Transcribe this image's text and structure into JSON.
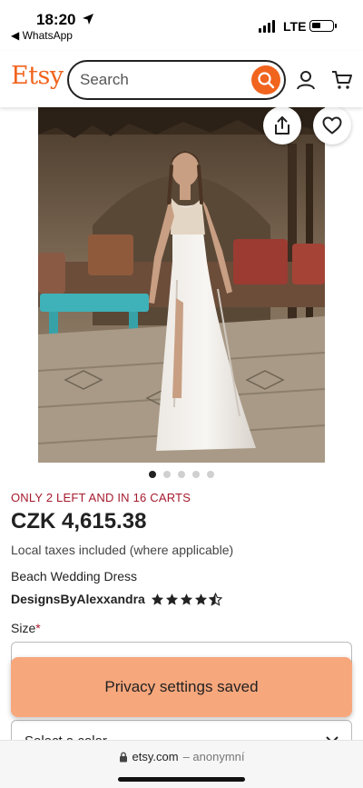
{
  "status_bar": {
    "time": "18:20",
    "back_app": "◀ WhatsApp",
    "network": "LTE"
  },
  "header": {
    "logo": "Etsy",
    "search_placeholder": "Search",
    "icons": [
      "search-icon",
      "user-icon",
      "cart-icon"
    ],
    "accent_color": "#f1641e"
  },
  "product": {
    "gallery": {
      "image_count": 5,
      "active_index": 0,
      "actions": [
        "share-icon",
        "heart-icon"
      ]
    },
    "scarcity_text": "ONLY 2 LEFT AND IN 16 CARTS",
    "price": "CZK 4,615.38",
    "taxes_note": "Local taxes included (where applicable)",
    "title": "Beach Wedding Dress",
    "shop_name": "DesignsByAlexxandra",
    "rating": 4.5,
    "size_label": "Size",
    "required_marker": "*",
    "color_select_text": "Select a color"
  },
  "toast": {
    "message": "Privacy settings saved",
    "color": "#f7a77c"
  },
  "browser": {
    "domain": "etsy.com",
    "extra": "– anonymní"
  }
}
